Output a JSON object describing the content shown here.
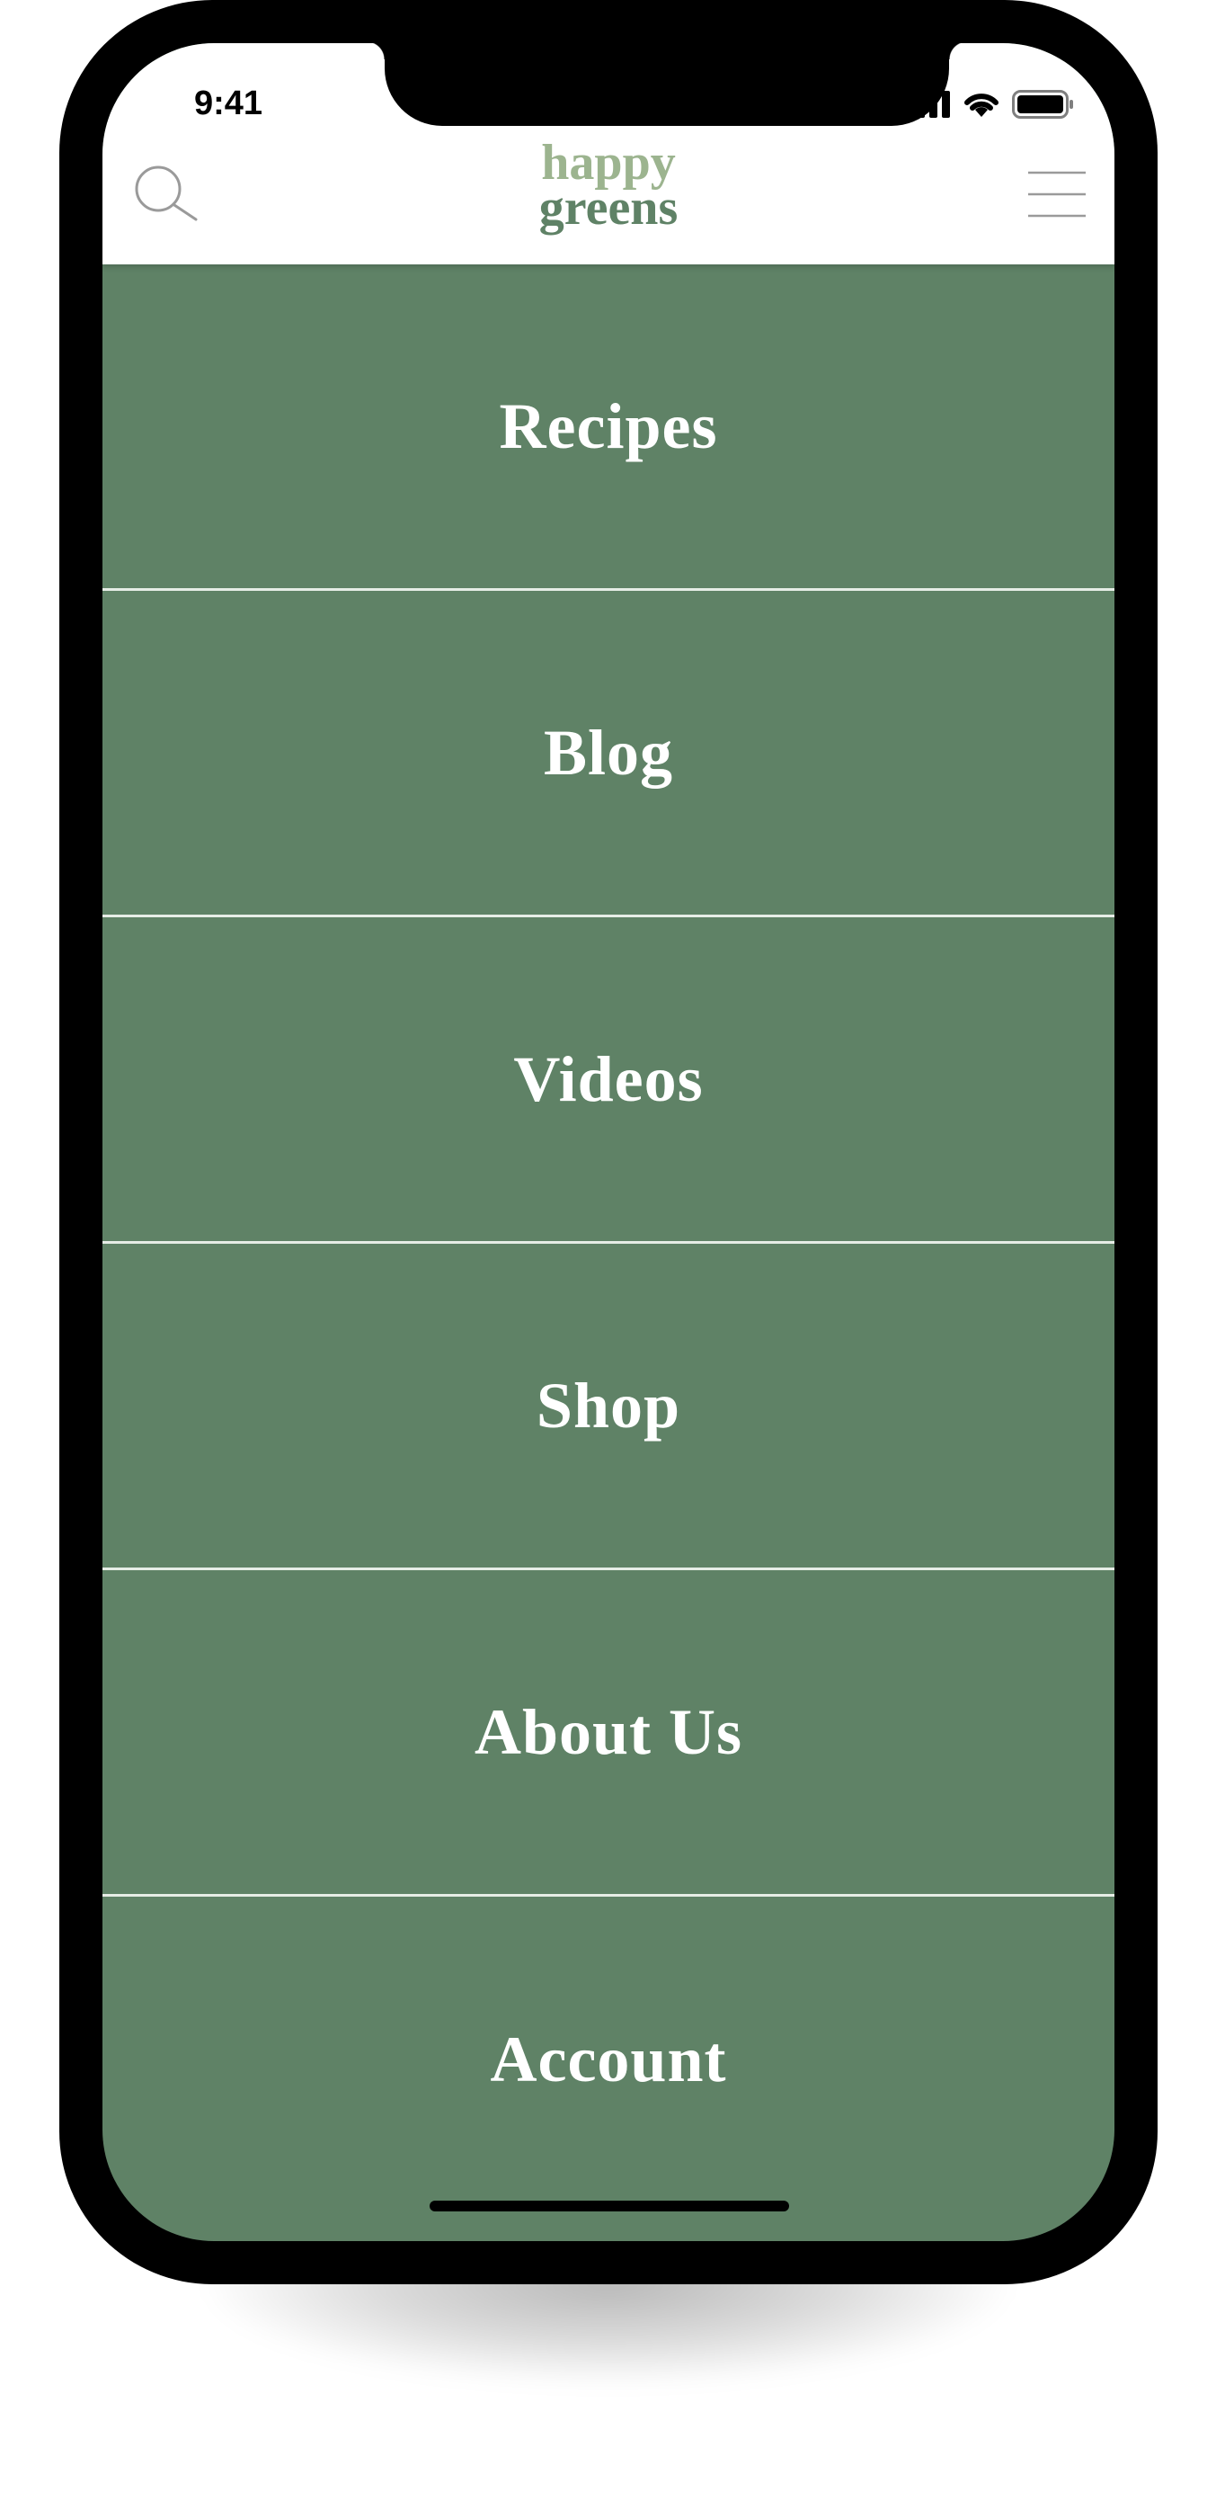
{
  "status_bar": {
    "time": "9:41",
    "icons": [
      "cellular-signal-icon",
      "wifi-icon",
      "battery-icon"
    ]
  },
  "header": {
    "brand_line1": "happy",
    "brand_line2": "greens",
    "left_icon": "search-icon",
    "right_icon": "hamburger-menu-icon"
  },
  "menu": {
    "items": [
      {
        "label": "Recipes"
      },
      {
        "label": "Blog"
      },
      {
        "label": "Videos"
      },
      {
        "label": "Shop"
      },
      {
        "label": "About Us"
      },
      {
        "label": "Account"
      }
    ]
  },
  "colors": {
    "menu_background": "#5f8266",
    "menu_text": "#ffffff",
    "divider": "#e6ede6",
    "brand_light": "#9cb48f",
    "brand_dark": "#5f8266",
    "icon_gray": "#9a9a9a"
  }
}
